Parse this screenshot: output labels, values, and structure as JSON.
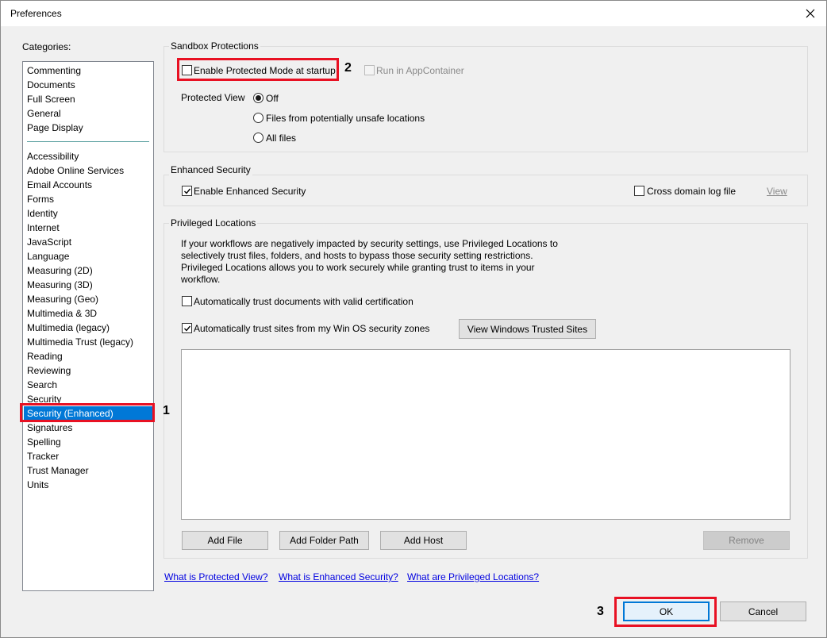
{
  "window": {
    "title": "Preferences"
  },
  "categories": {
    "label": "Categories:",
    "group1": [
      "Commenting",
      "Documents",
      "Full Screen",
      "General",
      "Page Display"
    ],
    "group2": [
      "Accessibility",
      "Adobe Online Services",
      "Email Accounts",
      "Forms",
      "Identity",
      "Internet",
      "JavaScript",
      "Language",
      "Measuring (2D)",
      "Measuring (3D)",
      "Measuring (Geo)",
      "Multimedia & 3D",
      "Multimedia (legacy)",
      "Multimedia Trust (legacy)",
      "Reading",
      "Reviewing",
      "Search",
      "Security",
      "Security (Enhanced)",
      "Signatures",
      "Spelling",
      "Tracker",
      "Trust Manager",
      "Units"
    ],
    "selected": "Security (Enhanced)"
  },
  "sandbox": {
    "title": "Sandbox Protections",
    "protected_mode_label": "Enable Protected Mode at startup",
    "protected_mode_checked": false,
    "appcontainer_label": "Run in AppContainer",
    "appcontainer_checked": false,
    "protected_view_label": "Protected View",
    "protected_view_options": [
      "Off",
      "Files from potentially unsafe locations",
      "All files"
    ],
    "protected_view_selected": "Off"
  },
  "enhanced": {
    "title": "Enhanced Security",
    "enable_label": "Enable Enhanced Security",
    "enable_checked": true,
    "cross_domain_label": "Cross domain log file",
    "cross_domain_checked": false,
    "view_link": "View"
  },
  "privileged": {
    "title": "Privileged Locations",
    "description": [
      "If your workflows are negatively impacted by security settings, use Privileged Locations to",
      "selectively trust files, folders, and hosts to bypass those security setting restrictions.",
      "Privileged Locations allows you to work securely while granting trust to items in your",
      "workflow."
    ],
    "trust_cert_label": "Automatically trust documents with valid certification",
    "trust_cert_checked": false,
    "trust_sites_label": "Automatically trust sites from my Win OS security zones",
    "trust_sites_checked": true,
    "view_sites_button": "View Windows Trusted Sites",
    "add_file_button": "Add File",
    "add_folder_button": "Add Folder Path",
    "add_host_button": "Add Host",
    "remove_button": "Remove"
  },
  "links": {
    "protected_view": "What is Protected View?",
    "enhanced_security": "What is Enhanced Security?",
    "privileged_locations": "What are Privileged Locations?"
  },
  "footer": {
    "ok": "OK",
    "cancel": "Cancel"
  },
  "annotations": {
    "one": "1",
    "two": "2",
    "three": "3"
  },
  "colors": {
    "accent": "#0078d7",
    "annotation": "#e81123",
    "link": "#0000e0"
  }
}
